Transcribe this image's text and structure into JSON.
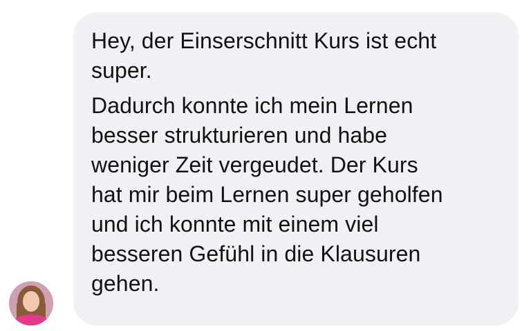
{
  "message": {
    "sender": {
      "avatar_icon": "profile-photo-woman-pink-top"
    },
    "paragraphs": [
      "Hey, der Einserschnitt Kurs ist echt\nsuper.",
      "Dadurch konnte ich mein Lernen\nbesser strukturieren und habe\nweniger Zeit vergeudet. Der Kurs\nhat mir beim Lernen super geholfen\nund ich konnte mit einem viel\nbesseren Gefühl in die Klausuren\ngehen."
    ],
    "bubble_color": "#f0f1f5",
    "text_color": "#111111"
  }
}
